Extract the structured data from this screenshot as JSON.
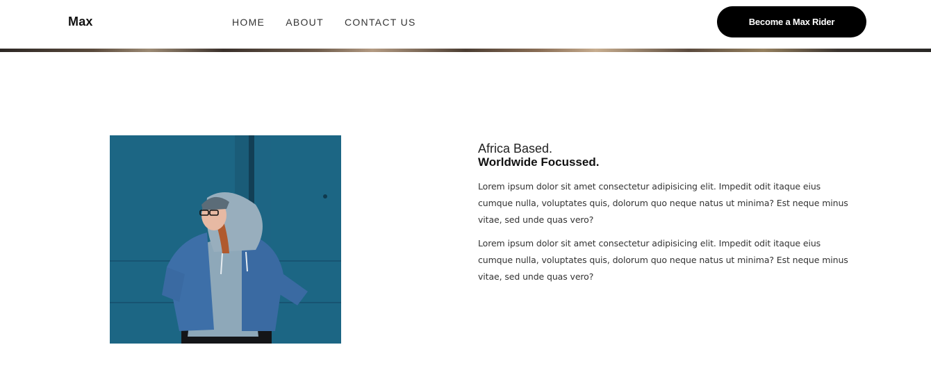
{
  "header": {
    "logo": "Max",
    "nav": [
      {
        "label": "HOME"
      },
      {
        "label": "ABOUT"
      },
      {
        "label": "CONTACT US"
      }
    ],
    "cta_label": "Become a Max Rider"
  },
  "about": {
    "image": {
      "alt": "Woman in denim jacket and grey hoodie against blue wall"
    },
    "title_line1": "Africa Based.",
    "title_line2": "Worldwide Focussed.",
    "paragraphs": [
      "Lorem ipsum dolor sit amet consectetur adipisicing elit. Impedit odit itaque eius cumque nulla, voluptates quis, dolorum quo neque natus ut minima? Est neque minus vitae, sed unde quas vero?",
      "Lorem ipsum dolor sit amet consectetur adipisicing elit. Impedit odit itaque eius cumque nulla, voluptates quis, dolorum quo neque natus ut minima? Est neque minus vitae, sed unde quas vero?"
    ]
  },
  "colors": {
    "cta_background": "#000000",
    "photo_wall": "#1f6b8a"
  }
}
